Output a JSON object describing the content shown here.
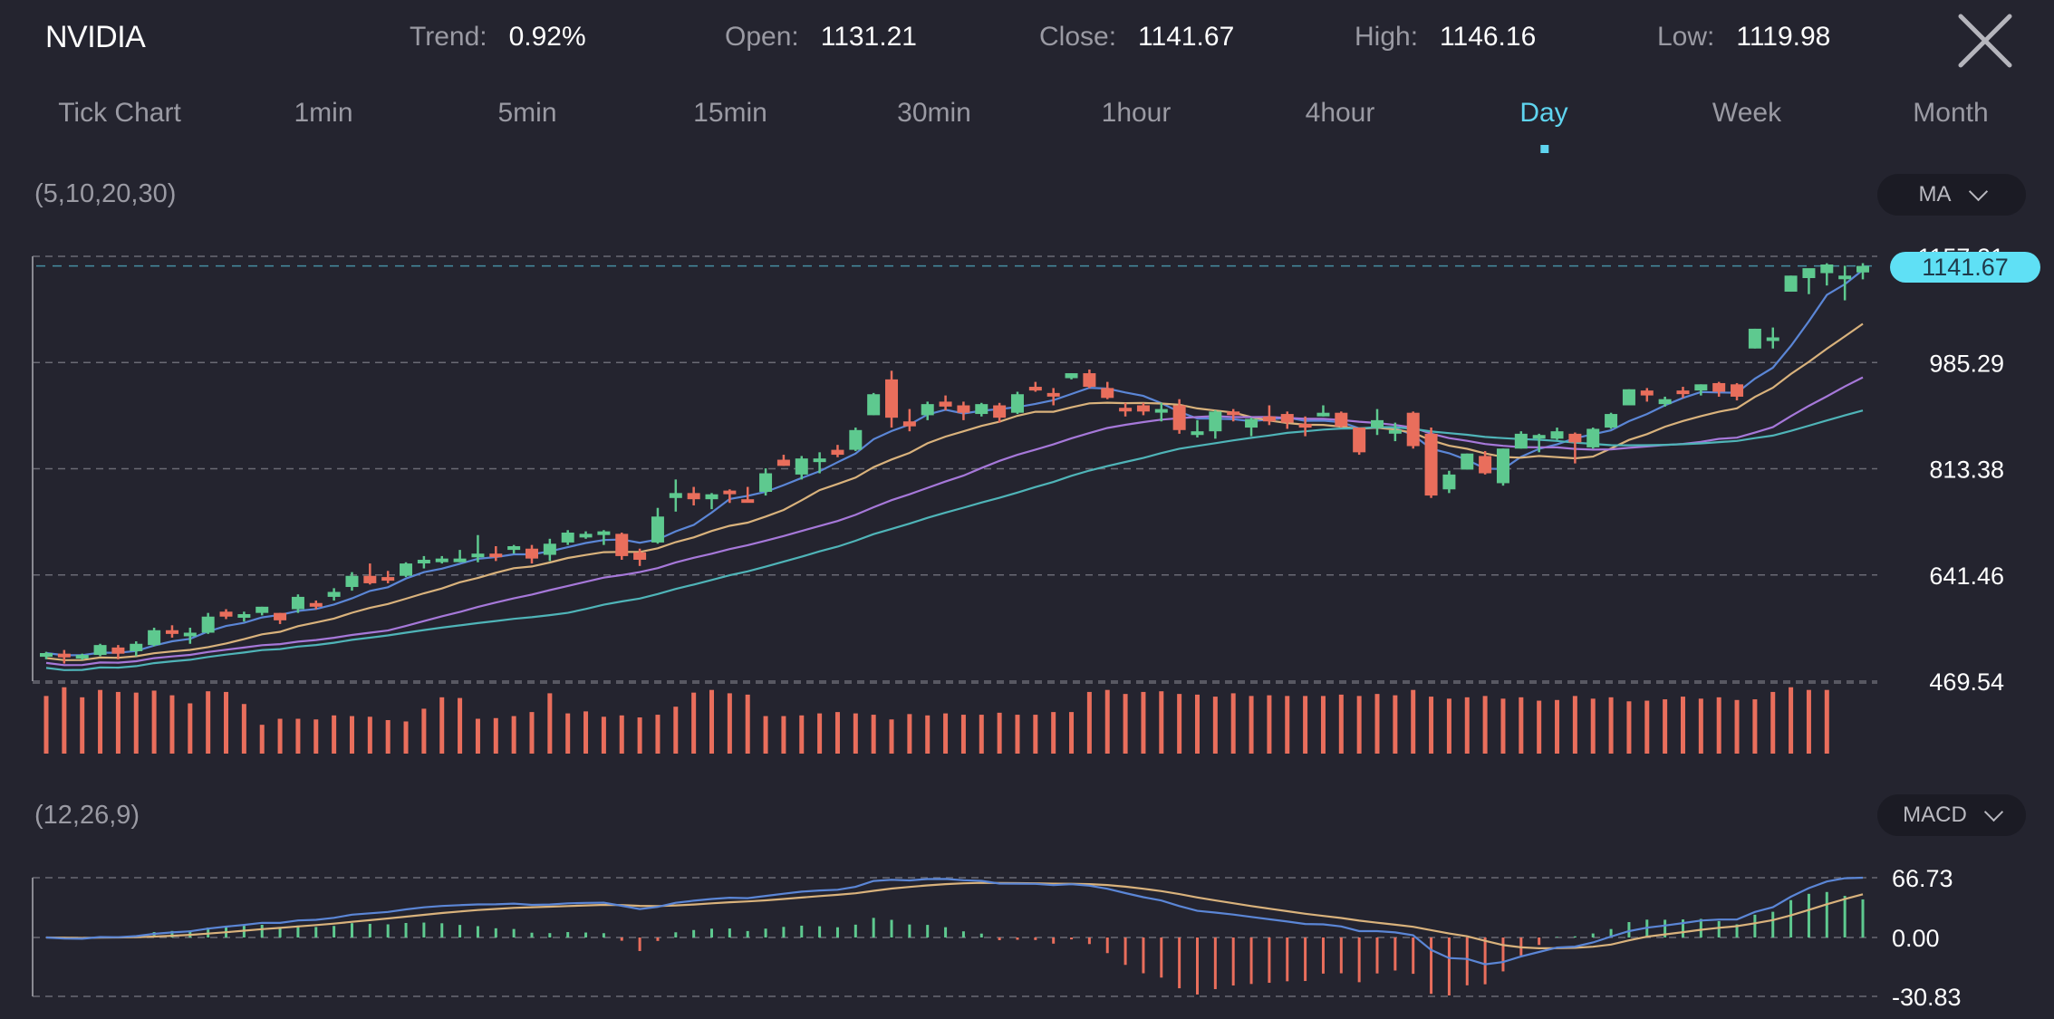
{
  "header": {
    "ticker": "NVIDIA",
    "stats": [
      {
        "label": "Trend:",
        "value": "0.92%"
      },
      {
        "label": "Open:",
        "value": "1131.21"
      },
      {
        "label": "Close:",
        "value": "1141.67"
      },
      {
        "label": "High:",
        "value": "1146.16"
      },
      {
        "label": "Low:",
        "value": "1119.98"
      }
    ],
    "close_icon": "close-x-icon"
  },
  "tabs": [
    {
      "label": "Tick Chart",
      "active": false
    },
    {
      "label": "1min",
      "active": false
    },
    {
      "label": "5min",
      "active": false
    },
    {
      "label": "15min",
      "active": false
    },
    {
      "label": "30min",
      "active": false
    },
    {
      "label": "1hour",
      "active": false
    },
    {
      "label": "4hour",
      "active": false
    },
    {
      "label": "Day",
      "active": true
    },
    {
      "label": "Week",
      "active": false
    },
    {
      "label": "Month",
      "active": false
    }
  ],
  "indicators": {
    "ma_params": "(5,10,20,30)",
    "ma_select": "MA",
    "macd_params": "(12,26,9)",
    "macd_select": "MACD"
  },
  "colors": {
    "up": "#5ec98f",
    "down": "#e96e5c",
    "ma5": "#5b86d6",
    "ma10": "#d9b27c",
    "ma20": "#a678d9",
    "ma30": "#4fb4b8",
    "accent": "#5fd4ef",
    "grid": "#6a6a74"
  },
  "chart_data": [
    {
      "type": "candlestick",
      "title": "NVIDIA Day",
      "ylim": [
        469.54,
        1157.21
      ],
      "y_ticks": [
        "1157.21",
        "985.29",
        "813.38",
        "641.46",
        "469.54"
      ],
      "current_price": "1141.67",
      "ma_periods": [
        5,
        10,
        20,
        30
      ],
      "ohlc": [
        [
          509,
          517,
          505,
          515
        ],
        [
          514,
          520,
          498,
          508
        ],
        [
          510,
          514,
          504,
          512
        ],
        [
          512,
          530,
          510,
          528
        ],
        [
          524,
          528,
          505,
          514
        ],
        [
          518,
          534,
          510,
          530
        ],
        [
          528,
          556,
          526,
          552
        ],
        [
          552,
          560,
          540,
          546
        ],
        [
          548,
          556,
          530,
          548
        ],
        [
          548,
          580,
          546,
          574
        ],
        [
          582,
          586,
          570,
          574
        ],
        [
          578,
          582,
          566,
          578
        ],
        [
          580,
          590,
          576,
          590
        ],
        [
          580,
          580,
          562,
          568
        ],
        [
          586,
          610,
          580,
          606
        ],
        [
          596,
          600,
          586,
          590
        ],
        [
          606,
          620,
          600,
          614
        ],
        [
          622,
          646,
          616,
          640
        ],
        [
          640,
          660,
          626,
          628
        ],
        [
          638,
          648,
          628,
          636
        ],
        [
          640,
          662,
          638,
          660
        ],
        [
          662,
          672,
          652,
          666
        ],
        [
          666,
          672,
          660,
          668
        ],
        [
          666,
          682,
          662,
          668
        ],
        [
          670,
          706,
          662,
          676
        ],
        [
          676,
          688,
          664,
          674
        ],
        [
          682,
          690,
          676,
          688
        ],
        [
          684,
          690,
          660,
          668
        ],
        [
          674,
          700,
          664,
          692
        ],
        [
          694,
          714,
          690,
          710
        ],
        [
          706,
          712,
          700,
          708
        ],
        [
          712,
          714,
          690,
          712
        ],
        [
          708,
          710,
          666,
          672
        ],
        [
          678,
          684,
          656,
          666
        ],
        [
          694,
          750,
          692,
          736
        ],
        [
          766,
          796,
          744,
          774
        ],
        [
          774,
          784,
          754,
          764
        ],
        [
          764,
          774,
          748,
          772
        ],
        [
          778,
          780,
          758,
          776
        ],
        [
          764,
          784,
          760,
          762
        ],
        [
          776,
          814,
          770,
          806
        ],
        [
          828,
          836,
          818,
          818
        ],
        [
          804,
          834,
          796,
          830
        ],
        [
          830,
          840,
          806,
          830
        ],
        [
          844,
          852,
          832,
          836
        ],
        [
          844,
          880,
          842,
          876
        ],
        [
          900,
          936,
          900,
          934
        ],
        [
          958,
          972,
          880,
          896
        ],
        [
          890,
          910,
          874,
          882
        ],
        [
          900,
          922,
          892,
          918
        ],
        [
          922,
          932,
          908,
          914
        ],
        [
          916,
          922,
          892,
          904
        ],
        [
          902,
          920,
          898,
          918
        ],
        [
          916,
          920,
          888,
          896
        ],
        [
          904,
          938,
          902,
          934
        ],
        [
          946,
          954,
          938,
          940
        ],
        [
          936,
          944,
          916,
          934
        ],
        [
          960,
          968,
          958,
          968
        ],
        [
          968,
          974,
          944,
          946
        ],
        [
          944,
          954,
          926,
          928
        ],
        [
          912,
          920,
          898,
          908
        ],
        [
          916,
          920,
          900,
          906
        ],
        [
          910,
          920,
          890,
          910
        ],
        [
          916,
          926,
          870,
          876
        ],
        [
          868,
          892,
          864,
          874
        ],
        [
          874,
          908,
          862,
          906
        ],
        [
          906,
          910,
          890,
          902
        ],
        [
          880,
          896,
          866,
          894
        ],
        [
          898,
          916,
          884,
          890
        ],
        [
          902,
          906,
          878,
          888
        ],
        [
          886,
          898,
          866,
          880
        ],
        [
          900,
          916,
          898,
          904
        ],
        [
          904,
          906,
          880,
          882
        ],
        [
          880,
          880,
          836,
          840
        ],
        [
          880,
          910,
          868,
          892
        ],
        [
          876,
          888,
          858,
          876
        ],
        [
          904,
          906,
          846,
          850
        ],
        [
          870,
          880,
          766,
          770
        ],
        [
          780,
          810,
          774,
          804
        ],
        [
          812,
          838,
          812,
          838
        ],
        [
          834,
          842,
          804,
          806
        ],
        [
          790,
          846,
          786,
          846
        ],
        [
          846,
          874,
          846,
          870
        ],
        [
          868,
          870,
          840,
          868
        ],
        [
          862,
          880,
          860,
          874
        ],
        [
          870,
          872,
          822,
          856
        ],
        [
          848,
          880,
          846,
          878
        ],
        [
          880,
          904,
          878,
          902
        ],
        [
          916,
          942,
          916,
          942
        ],
        [
          940,
          944,
          922,
          932
        ],
        [
          918,
          930,
          914,
          926
        ],
        [
          940,
          946,
          928,
          938
        ],
        [
          940,
          950,
          932,
          950
        ],
        [
          952,
          954,
          930,
          938
        ],
        [
          950,
          952,
          924,
          930
        ],
        [
          1008,
          1040,
          1008,
          1040
        ],
        [
          1026,
          1042,
          1008,
          1026
        ],
        [
          1100,
          1126,
          1100,
          1126
        ],
        [
          1122,
          1132,
          1096,
          1138
        ],
        [
          1130,
          1146,
          1110,
          1144
        ],
        [
          1126,
          1142,
          1086,
          1126
        ],
        [
          1131.21,
          1146.16,
          1119.98,
          1141.67
        ]
      ],
      "volume_relative": [
        0.86,
        0.99,
        0.84,
        0.95,
        0.92,
        0.91,
        0.94,
        0.87,
        0.75,
        0.93,
        0.92,
        0.74,
        0.43,
        0.52,
        0.52,
        0.51,
        0.57,
        0.56,
        0.55,
        0.5,
        0.48,
        0.67,
        0.84,
        0.83,
        0.52,
        0.53,
        0.56,
        0.62,
        0.9,
        0.6,
        0.63,
        0.55,
        0.57,
        0.54,
        0.58,
        0.7,
        0.91,
        0.95,
        0.9,
        0.88,
        0.56,
        0.56,
        0.57,
        0.6,
        0.62,
        0.6,
        0.58,
        0.51,
        0.59,
        0.57,
        0.6,
        0.58,
        0.58,
        0.61,
        0.58,
        0.58,
        0.62,
        0.62,
        0.92,
        0.95,
        0.89,
        0.92,
        0.93,
        0.89,
        0.88,
        0.85,
        0.9,
        0.86,
        0.87,
        0.86,
        0.86,
        0.86,
        0.88,
        0.86,
        0.89,
        0.87,
        0.95,
        0.85,
        0.82,
        0.84,
        0.86,
        0.82,
        0.84,
        0.79,
        0.8,
        0.86,
        0.82,
        0.84,
        0.78,
        0.79,
        0.81,
        0.85,
        0.82,
        0.84,
        0.8,
        0.81,
        0.92,
        0.99,
        0.95,
        0.95
      ]
    },
    {
      "type": "macd",
      "params": [
        12,
        26,
        9
      ],
      "y_ticks": [
        "66.73",
        "0.00",
        "-30.83"
      ],
      "ylim": [
        -30.83,
        66.73
      ]
    }
  ]
}
